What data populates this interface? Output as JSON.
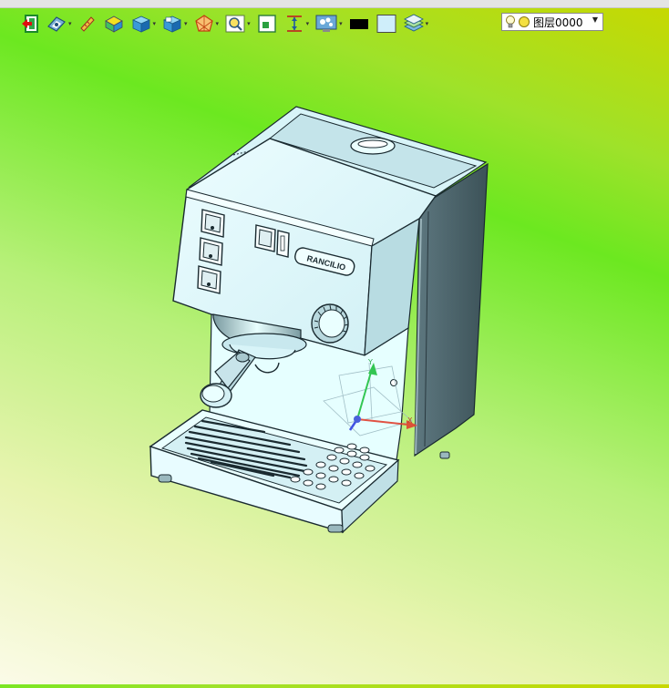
{
  "toolbar": {
    "tools": [
      {
        "name": "exit-icon"
      },
      {
        "name": "view-orient-icon"
      },
      {
        "name": "measure-icon"
      },
      {
        "name": "shaded-solid-icon"
      },
      {
        "name": "cube-view-icon"
      },
      {
        "name": "cube-section-icon"
      },
      {
        "name": "render-style-icon"
      },
      {
        "name": "zoom-fit-icon"
      },
      {
        "name": "zoom-window-icon"
      },
      {
        "name": "dimension-icon"
      },
      {
        "name": "display-settings-icon"
      },
      {
        "name": "black-color-swatch",
        "color": "#000000"
      },
      {
        "name": "light-blue-color-swatch",
        "color": "#cfeefa"
      },
      {
        "name": "layers-icon"
      }
    ],
    "layer": {
      "current_value": "图层0000",
      "icons": [
        "lightbulb-icon",
        "sun-circle-icon"
      ]
    }
  },
  "model": {
    "brand_text": "RANCILIO",
    "body_color": "#dffbff",
    "shadow_color": "#445a60",
    "edge_color": "#1a2a30"
  }
}
